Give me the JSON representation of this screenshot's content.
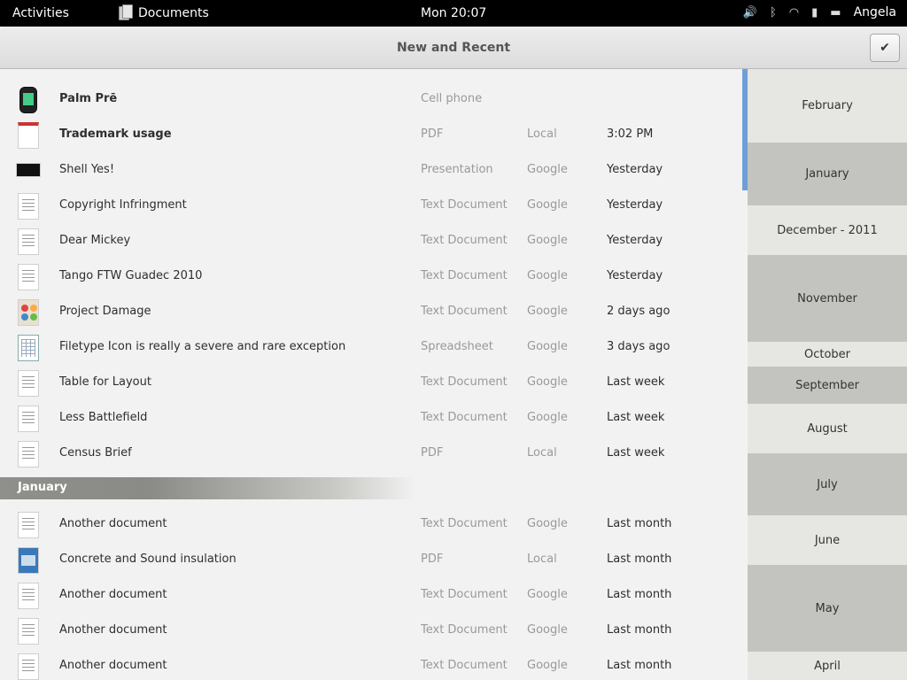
{
  "topbar": {
    "activities": "Activities",
    "app_name": "Documents",
    "clock": "Mon 20:07",
    "user": "Angela",
    "icons": [
      "volume-icon",
      "bluetooth-icon",
      "wifi-icon",
      "battery-icon",
      "chat-icon"
    ]
  },
  "header": {
    "title": "New and Recent",
    "check_label": "✔"
  },
  "documents": [
    {
      "name": "Palm Prē",
      "type": "Cell phone",
      "where": "",
      "when": "",
      "thumb": "phone",
      "bold": true
    },
    {
      "name": "Trademark usage",
      "type": "PDF",
      "where": "Local",
      "when": "3:02 PM",
      "thumb": "pdf",
      "bold": true
    },
    {
      "name": "Shell Yes!",
      "type": "Presentation",
      "where": "Google",
      "when": "Yesterday",
      "thumb": "pres",
      "bold": false
    },
    {
      "name": "Copyright Infringment",
      "type": "Text Document",
      "where": "Google",
      "when": "Yesterday",
      "thumb": "text",
      "bold": false
    },
    {
      "name": "Dear Mickey",
      "type": "Text Document",
      "where": "Google",
      "when": "Yesterday",
      "thumb": "text",
      "bold": false
    },
    {
      "name": "Tango FTW Guadec 2010",
      "type": "Text Document",
      "where": "Google",
      "when": "Yesterday",
      "thumb": "text",
      "bold": false
    },
    {
      "name": "Project Damage",
      "type": "Text Document",
      "where": "Google",
      "when": "2 days ago",
      "thumb": "img",
      "bold": false
    },
    {
      "name": "Filetype Icon is really a severe and rare exception",
      "type": "Spreadsheet",
      "where": "Google",
      "when": "3 days ago",
      "thumb": "sheet",
      "bold": false
    },
    {
      "name": "Table for Layout",
      "type": "Text Document",
      "where": "Google",
      "when": "Last week",
      "thumb": "text",
      "bold": false
    },
    {
      "name": "Less Battlefield",
      "type": "Text Document",
      "where": "Google",
      "when": "Last week",
      "thumb": "text",
      "bold": false
    },
    {
      "name": "Census Brief",
      "type": "PDF",
      "where": "Local",
      "when": "Last week",
      "thumb": "text",
      "bold": false
    }
  ],
  "section_january": "January",
  "january_documents": [
    {
      "name": "Another document",
      "type": "Text Document",
      "where": "Google",
      "when": "Last month",
      "thumb": "text"
    },
    {
      "name": "Concrete and Sound insulation",
      "type": "PDF",
      "where": "Local",
      "when": "Last month",
      "thumb": "blue"
    },
    {
      "name": "Another document",
      "type": "Text Document",
      "where": "Google",
      "when": "Last month",
      "thumb": "text"
    },
    {
      "name": "Another document",
      "type": "Text Document",
      "where": "Google",
      "when": "Last month",
      "thumb": "text"
    },
    {
      "name": "Another document",
      "type": "Text Document",
      "where": "Google",
      "when": "Last month",
      "thumb": "text"
    }
  ],
  "timeline": [
    "February",
    "January",
    "December - 2011",
    "November",
    "October",
    "September",
    "August",
    "July",
    "June",
    "May",
    "April"
  ],
  "colors": {
    "topbar": "#000000",
    "scrollbar": "#6e9fd8",
    "section_header": "#8a8a86"
  }
}
